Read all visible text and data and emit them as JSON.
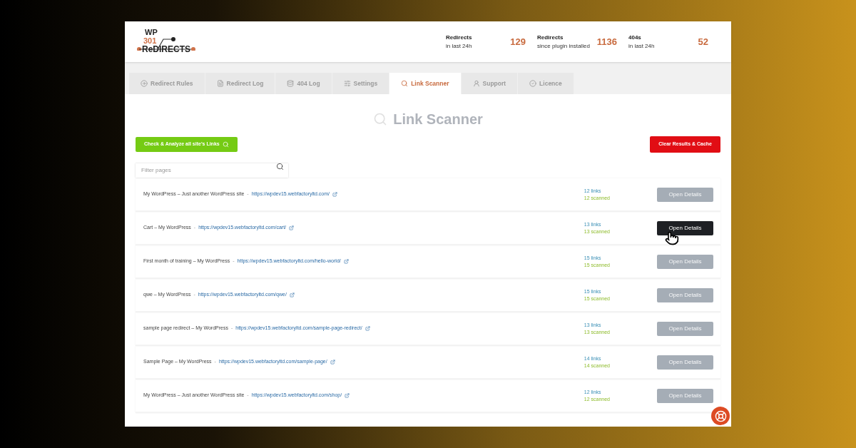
{
  "logo": {
    "top": "WP",
    "number": "301",
    "name": "ReDIRECTS"
  },
  "stats": [
    {
      "label": "Redirects",
      "sub": "in last 24h",
      "value": "129"
    },
    {
      "label": "Redirects",
      "sub": "since plugin installed",
      "value": "1136"
    },
    {
      "label": "404s",
      "sub": "in last 24h",
      "value": "52"
    }
  ],
  "tabs": [
    {
      "label": "Redirect Rules",
      "selected": false
    },
    {
      "label": "Redirect Log",
      "selected": false
    },
    {
      "label": "404 Log",
      "selected": false
    },
    {
      "label": "Settings",
      "selected": false
    },
    {
      "label": "Link Scanner",
      "selected": true
    },
    {
      "label": "Support",
      "selected": false
    },
    {
      "label": "Licence",
      "selected": false
    }
  ],
  "heading": "Link Scanner",
  "analyze_button": "Check & Analyze all site's Links",
  "clear_button": "Clear Results & Cache",
  "filter": {
    "placeholder": "Filter pages"
  },
  "rows": [
    {
      "title": "My WordPress – Just another WordPress site",
      "separator": "-",
      "url": "https://wpdev15.webfactoryltd.com/",
      "links": "12 links",
      "scanned": "12 scanned",
      "button": "Open Details",
      "hovered": false
    },
    {
      "title": "Cart – My WordPress",
      "separator": "-",
      "url": "https://wpdev15.webfactoryltd.com/cart/",
      "links": "13 links",
      "scanned": "13 scanned",
      "button": "Open Details",
      "hovered": true
    },
    {
      "title": "First month of training – My WordPress",
      "separator": "-",
      "url": "https://wpdev15.webfactoryltd.com/hello-world/",
      "links": "15 links",
      "scanned": "15 scanned",
      "button": "Open Details",
      "hovered": false
    },
    {
      "title": "qwe – My WordPress",
      "separator": "-",
      "url": "https://wpdev15.webfactoryltd.com/qwe/",
      "links": "15 links",
      "scanned": "15 scanned",
      "button": "Open Details",
      "hovered": false
    },
    {
      "title": "sample page redirect – My WordPress",
      "separator": "-",
      "url": "https://wpdev15.webfactoryltd.com/sample-page-redirect/",
      "links": "13 links",
      "scanned": "13 scanned",
      "button": "Open Details",
      "hovered": false
    },
    {
      "title": "Sample Page – My WordPress",
      "separator": "-",
      "url": "https://wpdev15.webfactoryltd.com/sample-page/",
      "links": "14 links",
      "scanned": "14 scanned",
      "button": "Open Details",
      "hovered": false
    },
    {
      "title": "My WordPress – Just another WordPress site",
      "separator": "-",
      "url": "https://wpdev15.webfactoryltd.com/shop/",
      "links": "12 links",
      "scanned": "12 scanned",
      "button": "Open Details",
      "hovered": false
    }
  ]
}
